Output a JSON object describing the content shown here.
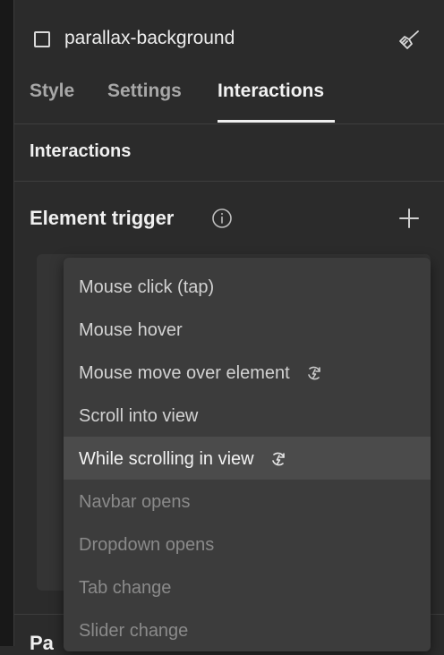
{
  "element": {
    "name": "parallax-background"
  },
  "tabs": [
    {
      "label": "Style"
    },
    {
      "label": "Settings"
    },
    {
      "label": "Interactions"
    }
  ],
  "active_tab": "Interactions",
  "section": {
    "title": "Interactions"
  },
  "trigger": {
    "title": "Element trigger"
  },
  "dropdown": {
    "items": [
      {
        "label": "Mouse click (tap)",
        "state": "normal",
        "icon": ""
      },
      {
        "label": "Mouse hover",
        "state": "normal",
        "icon": ""
      },
      {
        "label": "Mouse move over element",
        "state": "normal",
        "icon": "continuous-interaction-icon"
      },
      {
        "label": "Scroll into view",
        "state": "normal",
        "icon": ""
      },
      {
        "label": "While scrolling in view",
        "state": "highlighted",
        "icon": "continuous-interaction-icon"
      },
      {
        "label": "Navbar opens",
        "state": "disabled",
        "icon": ""
      },
      {
        "label": "Dropdown opens",
        "state": "disabled",
        "icon": ""
      },
      {
        "label": "Tab change",
        "state": "disabled",
        "icon": ""
      },
      {
        "label": "Slider change",
        "state": "disabled",
        "icon": ""
      }
    ]
  },
  "bottom_section": {
    "title": "Pa"
  },
  "colors": {
    "background": "#2b2b2b",
    "dropdown": "#3c3c3c",
    "highlight": "#4b4b4b",
    "text": "#e8e8e8",
    "muted": "#8a8a8a"
  }
}
